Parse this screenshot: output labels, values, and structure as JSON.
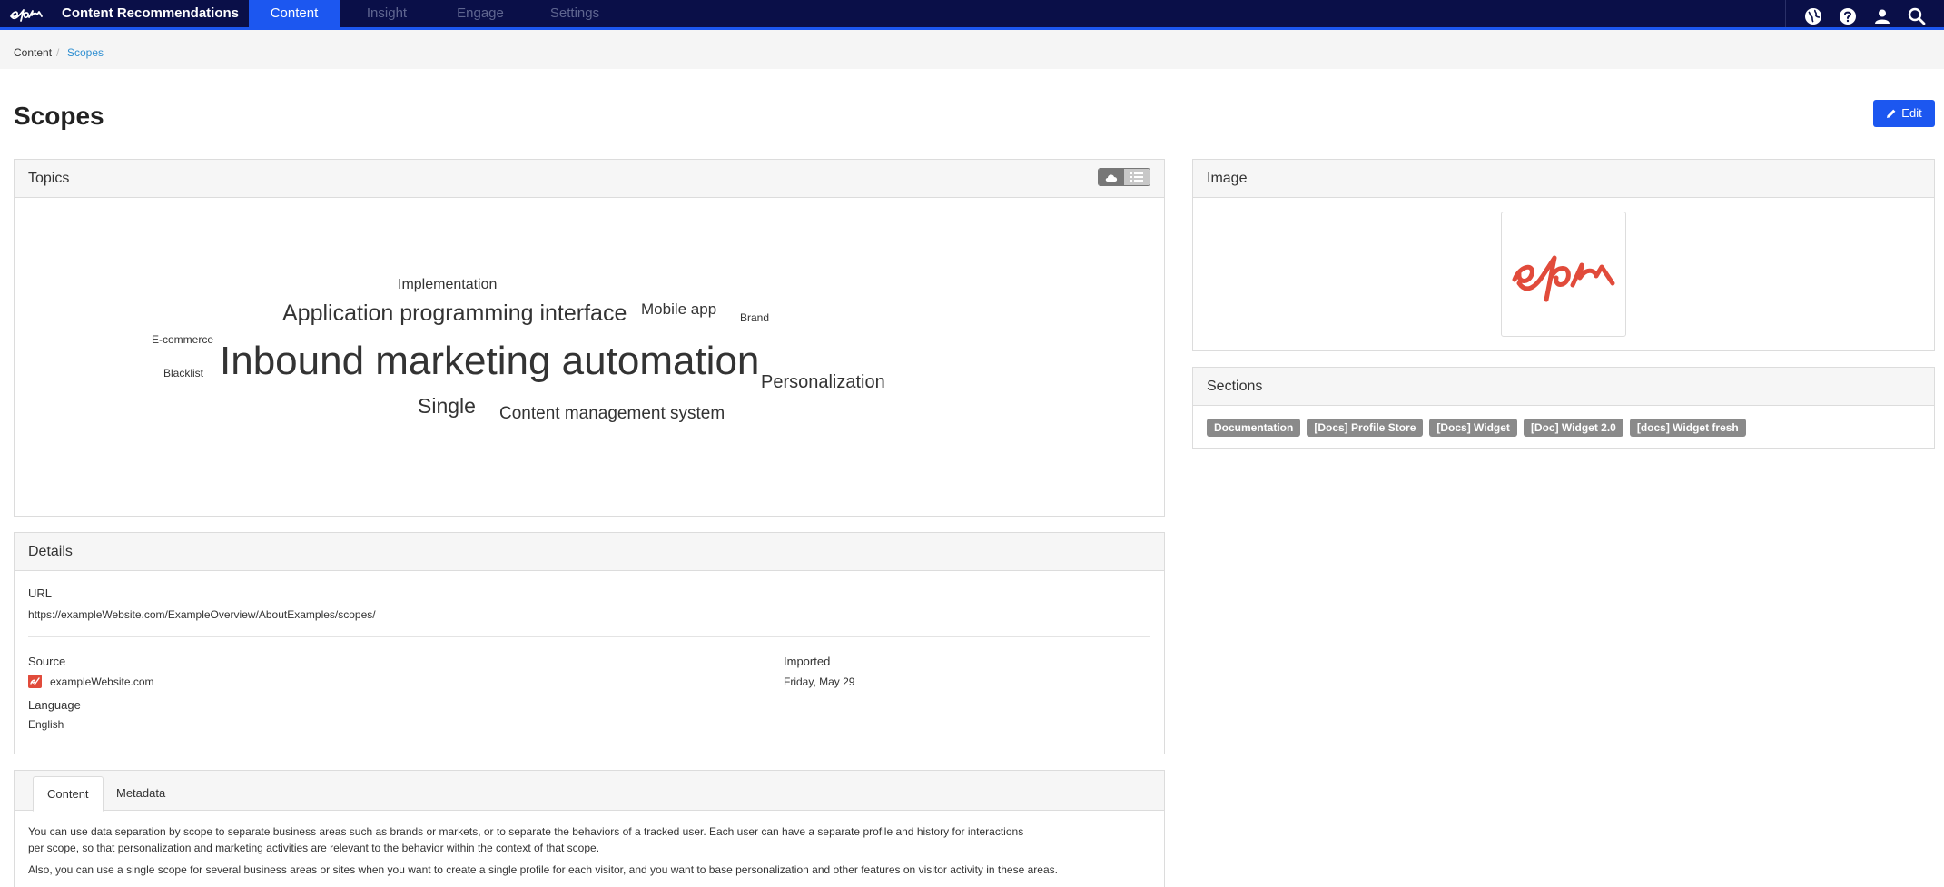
{
  "navbar": {
    "app_name": "Content Recommendations",
    "tabs": [
      {
        "label": "Content",
        "active": true
      },
      {
        "label": "Insight",
        "active": false
      },
      {
        "label": "Engage",
        "active": false
      },
      {
        "label": "Settings",
        "active": false
      }
    ],
    "icons": [
      "globe-icon",
      "help-icon",
      "user-icon",
      "search-icon"
    ],
    "accent_color": "#1c57f0",
    "background_color": "#0a0f48"
  },
  "breadcrumb": {
    "home": "Content",
    "separator": "/",
    "current": "Scopes"
  },
  "page": {
    "title": "Scopes",
    "edit_label": "Edit"
  },
  "topics": {
    "title": "Topics",
    "view_modes": [
      "cloud-icon",
      "list-icon"
    ],
    "words": [
      {
        "text": "Implementation",
        "weight": 2
      },
      {
        "text": "Application programming interface",
        "weight": 4
      },
      {
        "text": "Mobile app",
        "weight": 2
      },
      {
        "text": "Brand",
        "weight": 1
      },
      {
        "text": "E-commerce",
        "weight": 1
      },
      {
        "text": "Inbound marketing automation",
        "weight": 6
      },
      {
        "text": "Blacklist",
        "weight": 1
      },
      {
        "text": "Personalization",
        "weight": 3
      },
      {
        "text": "Single",
        "weight": 3
      },
      {
        "text": "Content management system",
        "weight": 3
      }
    ]
  },
  "details": {
    "title": "Details",
    "url_label": "URL",
    "url": "https://exampleWebsite.com/ExampleOverview/AboutExamples/scopes/",
    "source_label": "Source",
    "source": "exampleWebsite.com",
    "imported_label": "Imported",
    "imported": "Friday, May 29",
    "language_label": "Language",
    "language": "English"
  },
  "content_tabs": {
    "tabs": [
      {
        "label": "Content",
        "active": true
      },
      {
        "label": "Metadata",
        "active": false
      }
    ],
    "paragraphs": [
      "You can use data separation by scope to separate business areas such as brands or markets, or to separate the behaviors of a tracked user. Each user can have a separate profile and history for interactions",
      "per scope, so that personalization and marketing activities are relevant to the behavior within  the context of that scope.",
      "Also, you can use a single scope for several business areas or sites when you want to create a single profile for each visitor, and you want to base personalization and other features on visitor activity in these areas."
    ]
  },
  "image_panel": {
    "title": "Image",
    "logo_color": "#e14b3b"
  },
  "sections": {
    "title": "Sections",
    "badges": [
      "Documentation",
      "[Docs] Profile Store",
      "[Docs] Widget",
      "[Doc] Widget 2.0",
      "[docs] Widget fresh"
    ]
  }
}
